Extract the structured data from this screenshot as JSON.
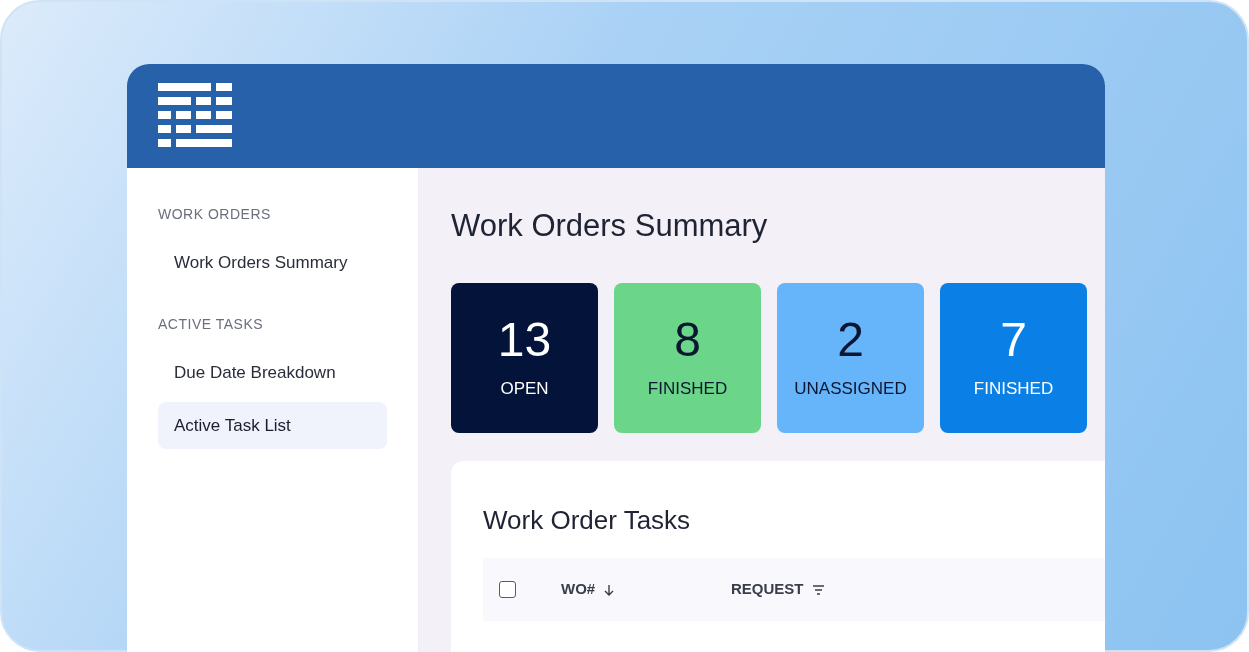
{
  "sidebar": {
    "sections": [
      {
        "heading": "WORK ORDERS",
        "items": [
          {
            "label": "Work Orders Summary",
            "selected": false
          }
        ]
      },
      {
        "heading": "ACTIVE TASKS",
        "items": [
          {
            "label": "Due Date Breakdown",
            "selected": false
          },
          {
            "label": "Active Task List",
            "selected": true
          }
        ]
      }
    ]
  },
  "page_title": "Work Orders Summary",
  "stats": [
    {
      "value": "13",
      "label": "OPEN",
      "color": "#04133a"
    },
    {
      "value": "8",
      "label": "FINISHED",
      "color": "#6bd68a"
    },
    {
      "value": "2",
      "label": "UNASSIGNED",
      "color": "#66b5fa"
    },
    {
      "value": "7",
      "label": "FINISHED",
      "color": "#0a80e6"
    }
  ],
  "table": {
    "title": "Work Order Tasks",
    "select_all": {
      "checked": false
    },
    "columns": [
      {
        "label": "WO#",
        "kind": "sort"
      },
      {
        "label": "REQUEST",
        "kind": "filter"
      }
    ]
  }
}
